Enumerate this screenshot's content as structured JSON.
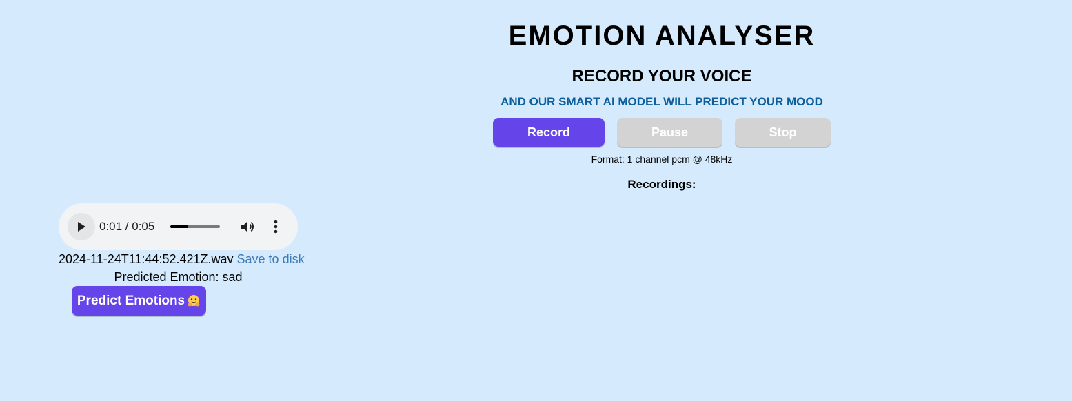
{
  "header": {
    "title": "EMOTION ANALYSER",
    "subtitle": "RECORD YOUR VOICE",
    "tagline": "AND OUR SMART AI MODEL WILL PREDICT YOUR MOOD"
  },
  "controls": {
    "record_label": "Record",
    "pause_label": "Pause",
    "stop_label": "Stop",
    "record_color": "#6544e9",
    "disabled_color": "#d3d3d3"
  },
  "format_text": "Format: 1 channel pcm @ 48kHz",
  "recordings_label": "Recordings:",
  "recording": {
    "player": {
      "time_display": "0:01 / 0:05",
      "progress_fraction": 0.35,
      "play_icon": "play-icon",
      "volume_icon": "volume-icon",
      "more_icon": "more-vert-icon"
    },
    "filename": "2024-11-24T11:44:52.421Z.wav",
    "save_label": "Save to disk",
    "predicted_text": "Predicted Emotion: sad",
    "predict_button_label": "Predict Emotions",
    "predict_icon": "hugging-face-icon"
  },
  "colors": {
    "background": "#d5ebfd",
    "tagline": "#0b5e9b",
    "link": "#3f7bb5"
  }
}
